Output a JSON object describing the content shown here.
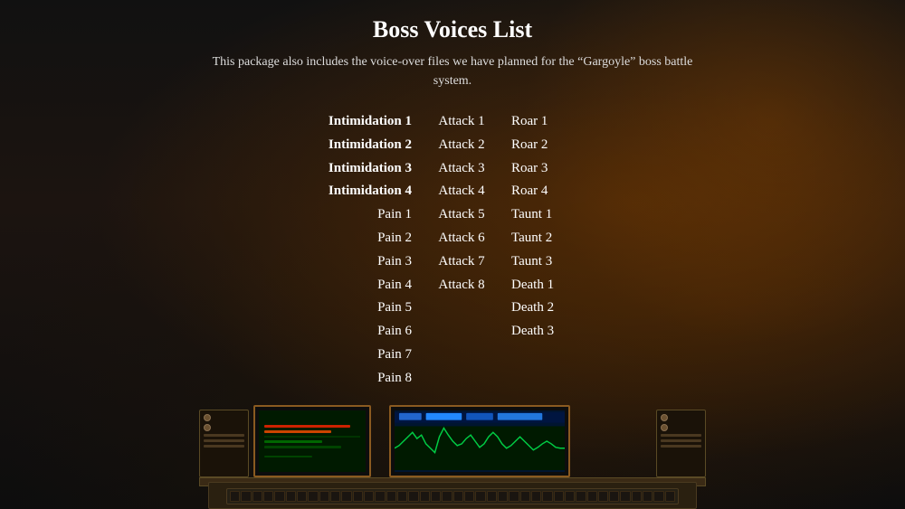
{
  "page": {
    "title": "Boss Voices List",
    "subtitle": "This package also includes the voice-over files we have planned for the “Gargoyle” boss battle system."
  },
  "voices": {
    "column1": [
      {
        "label": "Intimidation 1",
        "bold": true
      },
      {
        "label": "Intimidation 2",
        "bold": true
      },
      {
        "label": "Intimidation 3",
        "bold": true
      },
      {
        "label": "Intimidation 4",
        "bold": true
      },
      {
        "label": "Pain 1",
        "bold": false
      },
      {
        "label": "Pain 2",
        "bold": false
      },
      {
        "label": "Pain 3",
        "bold": false
      },
      {
        "label": "Pain 4",
        "bold": false
      },
      {
        "label": "Pain 5",
        "bold": false
      },
      {
        "label": "Pain 6",
        "bold": false
      },
      {
        "label": "Pain 7",
        "bold": false
      },
      {
        "label": "Pain 8",
        "bold": false
      }
    ],
    "column2": [
      {
        "label": "Attack 1",
        "bold": false
      },
      {
        "label": "Attack 2",
        "bold": false
      },
      {
        "label": "Attack 3",
        "bold": false
      },
      {
        "label": "Attack 4",
        "bold": false
      },
      {
        "label": "Attack 5",
        "bold": false
      },
      {
        "label": "Attack 6",
        "bold": false
      },
      {
        "label": "Attack 7",
        "bold": false
      },
      {
        "label": "Attack 8",
        "bold": false
      }
    ],
    "column3": [
      {
        "label": "Roar 1",
        "bold": false
      },
      {
        "label": "Roar 2",
        "bold": false
      },
      {
        "label": "Roar 3",
        "bold": false
      },
      {
        "label": "Roar 4",
        "bold": false
      },
      {
        "label": "Taunt 1",
        "bold": false
      },
      {
        "label": "Taunt 2",
        "bold": false
      },
      {
        "label": "Taunt 3",
        "bold": false
      },
      {
        "label": "Death 1",
        "bold": false
      },
      {
        "label": "Death 2",
        "bold": false
      },
      {
        "label": "Death 3",
        "bold": false
      }
    ]
  },
  "colors": {
    "accent": "#e05010",
    "waveform_green": "#00cc44",
    "waveform_blue": "#2288ff",
    "monitor_bg_left": "#001a00",
    "monitor_bg_right": "#001530"
  }
}
